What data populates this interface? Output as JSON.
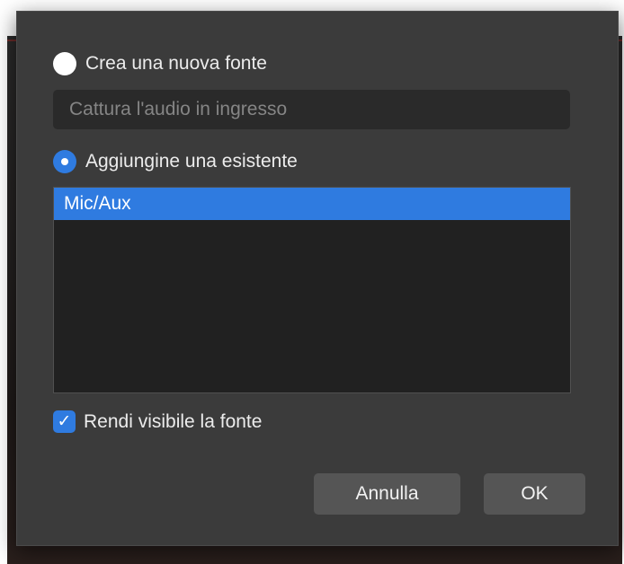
{
  "dialog": {
    "create_new": {
      "label": "Crea una nuova fonte",
      "selected": false,
      "placeholder": "Cattura l'audio in ingresso"
    },
    "add_existing": {
      "label": "Aggiungine una esistente",
      "selected": true
    },
    "sources": [
      {
        "label": "Mic/Aux",
        "selected": true
      }
    ],
    "visible_checkbox": {
      "label": "Rendi visibile la fonte",
      "checked": true,
      "check_glyph": "✓"
    },
    "buttons": {
      "cancel": "Annulla",
      "ok": "OK"
    },
    "colors": {
      "accent": "#2f7be0",
      "dialog_bg": "#3b3b3b",
      "list_bg": "#212121",
      "button_bg": "#555555"
    }
  }
}
